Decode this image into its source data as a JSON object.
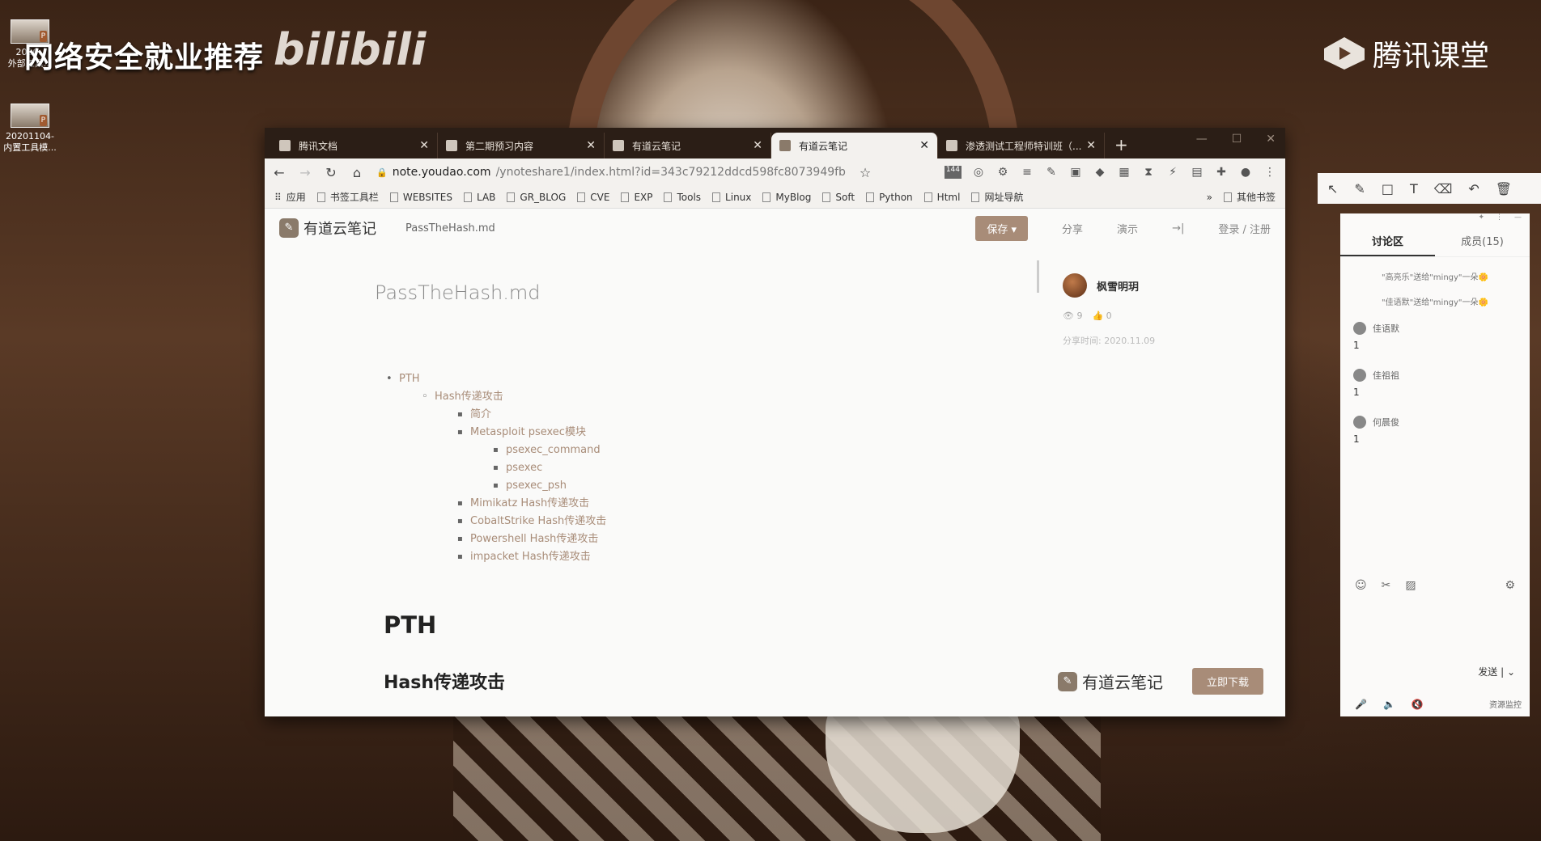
{
  "desktop": {
    "icons": [
      {
        "label": "2020..\n外部工具..."
      },
      {
        "label": "20201104-\n内置工具模..."
      }
    ],
    "stream_title": "网络安全就业推荐",
    "bili_logo": "bilibili",
    "tencent_logo": "腾讯课堂"
  },
  "browser": {
    "tabs": [
      {
        "label": "腾讯文档"
      },
      {
        "label": "第二期预习内容"
      },
      {
        "label": "有道云笔记"
      },
      {
        "label": "有道云笔记",
        "active": true
      },
      {
        "label": "渗透测试工程师特训班（..."
      }
    ],
    "url": {
      "host": "note.youdao.com",
      "path": "/ynoteshare1/index.html?id=343c79212ddcd598fc8073949fba6..."
    },
    "ext_badge": "144",
    "bookmarks": [
      "应用",
      "书签工具栏",
      "WEBSITES",
      "LAB",
      "GR_BLOG",
      "CVE",
      "EXP",
      "Tools",
      "Linux",
      "MyBlog",
      "Soft",
      "Python",
      "Html",
      "网址导航"
    ],
    "bookmarks_more": "»",
    "other_bookmarks": "其他书签"
  },
  "page": {
    "logo": "有道云笔记",
    "file_name": "PassTheHash.md",
    "save": "保存",
    "share": "分享",
    "present": "演示",
    "login": "登录 / 注册",
    "doc_title": "PassTheHash.md",
    "toc": {
      "l1": "PTH",
      "l2": "Hash传递攻击",
      "l3": [
        "简介",
        "Metasploit psexec模块"
      ],
      "l4": [
        "psexec_command",
        "psexec",
        "psexec_psh"
      ],
      "l3b": [
        "Mimikatz Hash传递攻击",
        "CobaltStrike Hash传递攻击",
        "Powershell Hash传递攻击",
        "impacket Hash传递攻击"
      ]
    },
    "h1": "PTH",
    "h2": "Hash传递攻击",
    "author": {
      "name": "枫雪明玥",
      "views": "9",
      "likes": "0",
      "date": "分享时间: 2020.11.09"
    },
    "footer_logo": "有道云笔记",
    "download": "立即下载"
  },
  "discussion": {
    "tab_discuss": "讨论区",
    "tab_members": "成员(15)",
    "system_msgs": [
      "\"高亮乐\"送给\"mingy\"一朵🌼",
      "\"佳语默\"送给\"mingy\"一朵🌼"
    ],
    "messages": [
      {
        "user": "佳语默",
        "text": "1"
      },
      {
        "user": "佳祖祖",
        "text": "1"
      },
      {
        "user": "何晨俊",
        "text": "1"
      }
    ],
    "send": "发送",
    "monitor": "资源监控"
  }
}
